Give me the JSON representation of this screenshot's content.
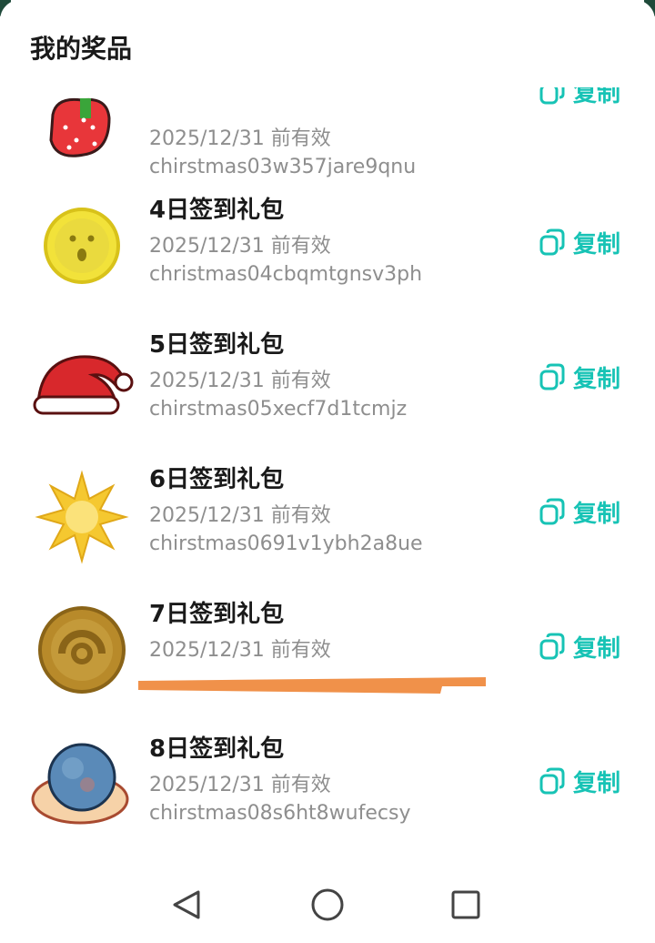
{
  "header": {
    "title": "我的奖品"
  },
  "prizes": [
    {
      "title": "",
      "expiry": "2025/12/31 前有效",
      "code": "chirstmas03w357jare9qnu",
      "icon": "strawberry-icon"
    },
    {
      "title": "4日签到礼包",
      "expiry": "2025/12/31 前有效",
      "code": "christmas04cbqmtgnsv3ph",
      "icon": "yellow-face-coin-icon"
    },
    {
      "title": "5日签到礼包",
      "expiry": "2025/12/31 前有效",
      "code": "chirstmas05xecf7d1tcmjz",
      "icon": "santa-hat-icon"
    },
    {
      "title": "6日签到礼包",
      "expiry": "2025/12/31 前有效",
      "code": "chirstmas0691v1ybh2a8ue",
      "icon": "star-burst-icon"
    },
    {
      "title": "7日签到礼包",
      "expiry": "2025/12/31 前有效",
      "code": "",
      "icon": "bronze-coin-icon"
    },
    {
      "title": "8日签到礼包",
      "expiry": "2025/12/31 前有效",
      "code": "chirstmas08s6ht8wufecsy",
      "icon": "globe-shell-icon"
    }
  ],
  "copy_label": "复制",
  "colors": {
    "accent": "#17c3b5",
    "title": "#1a1a1a",
    "secondary": "#8e8e8e",
    "redaction": "#f0914a"
  },
  "nav": {
    "back": "back-triangle-icon",
    "home": "home-circle-icon",
    "recent": "recent-square-icon"
  }
}
